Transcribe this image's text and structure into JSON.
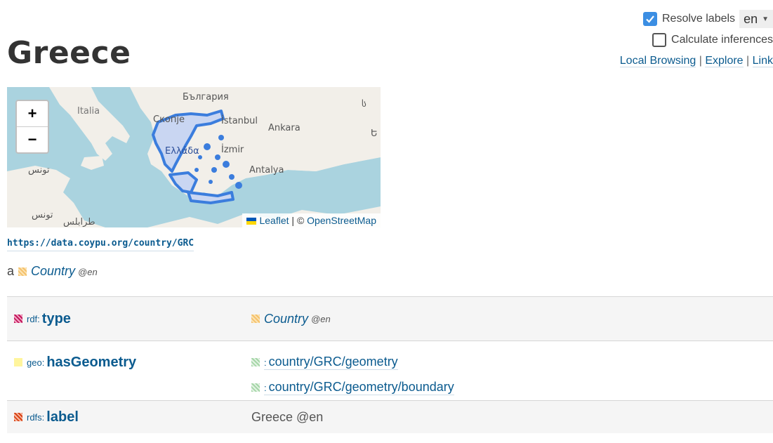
{
  "controls": {
    "resolve_labels": "Resolve labels",
    "language": "en",
    "calculate_inferences": "Calculate inferences",
    "links": [
      "Local Browsing",
      "Explore",
      "Link"
    ],
    "separator": "|"
  },
  "page_title": "Greece",
  "map": {
    "labels": [
      "България",
      "Italia",
      "Скопје",
      "İstanbul",
      "Ankara",
      "İzmir",
      "Antalya",
      "تونس",
      "تونس",
      "طرابلس",
      "Ελλάδα",
      "ს",
      "Ե"
    ],
    "zoom_in": "+",
    "zoom_out": "−",
    "attribution": {
      "leaflet": "Leaflet",
      "sep": "| ©",
      "osm": "OpenStreetMap"
    }
  },
  "resource_uri": "https://data.coypu.org/country/GRC",
  "type_line": {
    "a": "a",
    "value": "Country",
    "lang": "@en"
  },
  "properties": [
    {
      "prefix": "rdf:",
      "local": "type",
      "values": [
        {
          "text": "Country",
          "lang": "@en"
        }
      ]
    },
    {
      "prefix": "geo:",
      "local": "hasGeometry",
      "values": [
        {
          "prefix": ":",
          "text": "country/GRC/geometry"
        },
        {
          "prefix": ":",
          "text": "country/GRC/geometry/boundary"
        }
      ]
    },
    {
      "prefix": "rdfs:",
      "local": "label",
      "values": [
        {
          "text": "Greece @en"
        }
      ]
    }
  ],
  "colors": {
    "link": "#0b5b8f",
    "checkbox": "#3b8ee3",
    "rdf_swatch": "#c2185b",
    "geo_swatch": "#fff59d",
    "class_swatch": "#f5c26b",
    "geom_swatch": "#a5d6a7",
    "rdfs_swatch": "#d84315",
    "country_outline": "#3b7ddd"
  }
}
